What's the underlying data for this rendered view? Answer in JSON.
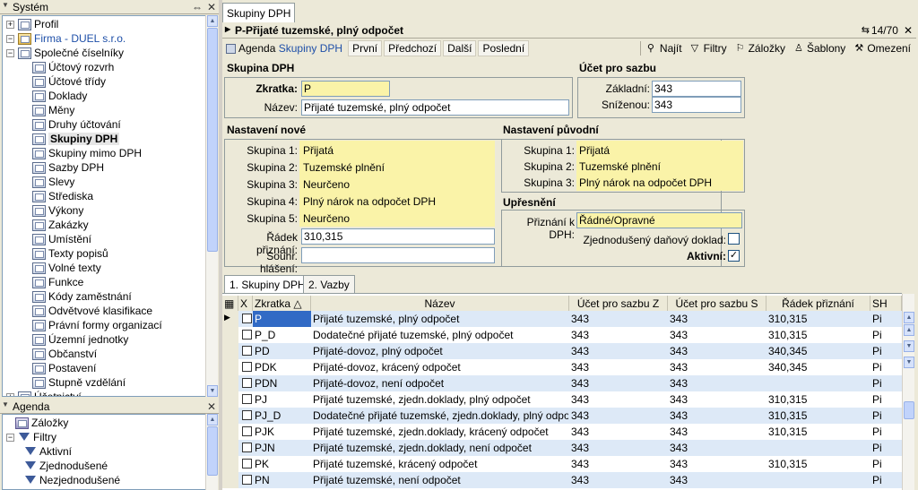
{
  "system_panel": {
    "title": "Systém"
  },
  "tree": {
    "items": [
      {
        "label": "Profil",
        "level": 0
      },
      {
        "label": "Firma - DUEL s.r.o.",
        "level": 0
      },
      {
        "label": "Společné číselníky",
        "level": 1
      },
      {
        "label": "Účtový rozvrh",
        "level": 2
      },
      {
        "label": "Účtové třídy",
        "level": 2
      },
      {
        "label": "Doklady",
        "level": 2
      },
      {
        "label": "Měny",
        "level": 2
      },
      {
        "label": "Druhy účtování",
        "level": 2
      },
      {
        "label": "Skupiny DPH",
        "level": 2
      },
      {
        "label": "Skupiny mimo DPH",
        "level": 2
      },
      {
        "label": "Sazby DPH",
        "level": 2
      },
      {
        "label": "Slevy",
        "level": 2
      },
      {
        "label": "Střediska",
        "level": 2
      },
      {
        "label": "Výkony",
        "level": 2
      },
      {
        "label": "Zakázky",
        "level": 2
      },
      {
        "label": "Umístění",
        "level": 2
      },
      {
        "label": "Texty popisů",
        "level": 2
      },
      {
        "label": "Volné texty",
        "level": 2
      },
      {
        "label": "Funkce",
        "level": 2
      },
      {
        "label": "Kódy zaměstnání",
        "level": 2
      },
      {
        "label": "Odvětvové klasifikace",
        "level": 2
      },
      {
        "label": "Právní formy organizací",
        "level": 2
      },
      {
        "label": "Územní jednotky",
        "level": 2
      },
      {
        "label": "Občanství",
        "level": 2
      },
      {
        "label": "Postavení",
        "level": 2
      },
      {
        "label": "Stupně vzdělání",
        "level": 2
      },
      {
        "label": "Účetnictví",
        "level": 1
      }
    ]
  },
  "agenda_panel": {
    "title": "Agenda",
    "items": [
      {
        "label": "Záložky"
      },
      {
        "label": "Filtry"
      },
      {
        "label": "Aktivní"
      },
      {
        "label": "Zjednodušené"
      },
      {
        "label": "Nezjednodušené"
      }
    ]
  },
  "doc_tab": "Skupiny DPH",
  "title": "P-Přijaté tuzemské, plný odpočet",
  "record_counter": "14/70",
  "toolbar": {
    "agenda": "Agenda",
    "agenda_link": "Skupiny DPH",
    "first": "První",
    "prev": "Předchozí",
    "next": "Další",
    "last": "Poslední",
    "find": "Najít",
    "filters": "Filtry",
    "bookmarks": "Záložky",
    "templates": "Šablony",
    "limit": "Omezení"
  },
  "form": {
    "group_dph": "Skupina DPH",
    "zkratka_label": "Zkratka:",
    "zkratka_value": "P",
    "nazev_label": "Název:",
    "nazev_value": "Přijaté tuzemské, plný odpočet",
    "group_ucet": "Účet pro sazbu",
    "zakladni_label": "Základní:",
    "zakladni_value": "343",
    "snizenou_label": "Sníženou:",
    "snizenou_value": "343",
    "group_nove": "Nastavení nové",
    "nove": [
      {
        "label": "Skupina 1:",
        "value": "Přijatá"
      },
      {
        "label": "Skupina 2:",
        "value": "Tuzemské plnění"
      },
      {
        "label": "Skupina 3:",
        "value": "Neurčeno"
      },
      {
        "label": "Skupina 4:",
        "value": "Plný nárok na odpočet DPH"
      },
      {
        "label": "Skupina 5:",
        "value": "Neurčeno"
      }
    ],
    "radek_label": "Řádek přiznání:",
    "radek_value": "310,315",
    "souhr_label": "Souhr. hlášení:",
    "souhr_value": "",
    "group_puvodni": "Nastavení původní",
    "puvodni": [
      {
        "label": "Skupina 1:",
        "value": "Přijatá"
      },
      {
        "label": "Skupina 2:",
        "value": "Tuzemské plnění"
      },
      {
        "label": "Skupina 3:",
        "value": "Plný nárok na odpočet DPH"
      }
    ],
    "group_upresneni": "Upřesnění",
    "priznani_label": "Přiznání k DPH:",
    "priznani_value": "Řádné/Opravné",
    "zjedn_label": "Zjednodušený daňový doklad:",
    "zjedn_checked": false,
    "aktivni_label": "Aktivní:",
    "aktivni_checked": true
  },
  "bottom_tabs": [
    "1. Skupiny DPH",
    "2. Vazby"
  ],
  "grid": {
    "columns": [
      "X",
      "Zkratka",
      "Název",
      "Účet pro sazbu Z",
      "Účet pro sazbu S",
      "Řádek přiznání",
      "SH"
    ],
    "rows": [
      [
        "P",
        "Přijaté tuzemské, plný odpočet",
        "343",
        "343",
        "310,315",
        "Pi"
      ],
      [
        "P_D",
        "Dodatečné přijaté tuzemské, plný odpočet",
        "343",
        "343",
        "310,315",
        "Pi"
      ],
      [
        "PD",
        "Přijaté-dovoz, plný odpočet",
        "343",
        "343",
        "340,345",
        "Pi"
      ],
      [
        "PDK",
        "Přijaté-dovoz, krácený odpočet",
        "343",
        "343",
        "340,345",
        "Pi"
      ],
      [
        "PDN",
        "Přijaté-dovoz, není odpočet",
        "343",
        "343",
        "",
        "Pi"
      ],
      [
        "PJ",
        "Přijaté tuzemské, zjedn.doklady, plný odpočet",
        "343",
        "343",
        "310,315",
        "Pi"
      ],
      [
        "PJ_D",
        "Dodatečné přijaté tuzemské, zjedn.doklady, plný odpočet",
        "343",
        "343",
        "310,315",
        "Pi"
      ],
      [
        "PJK",
        "Přijaté tuzemské, zjedn.doklady, krácený odpočet",
        "343",
        "343",
        "310,315",
        "Pi"
      ],
      [
        "PJN",
        "Přijaté tuzemské, zjedn.doklady, není odpočet",
        "343",
        "343",
        "",
        "Pi"
      ],
      [
        "PK",
        "Přijaté tuzemské, krácený odpočet",
        "343",
        "343",
        "310,315",
        "Pi"
      ],
      [
        "PN",
        "Přijaté tuzemské, není odpočet",
        "343",
        "343",
        "",
        "Pi"
      ]
    ]
  },
  "colors": {
    "row_alt": "#dde9f7",
    "row_sel": "#316ac5",
    "yellow": "#faf3a8"
  }
}
